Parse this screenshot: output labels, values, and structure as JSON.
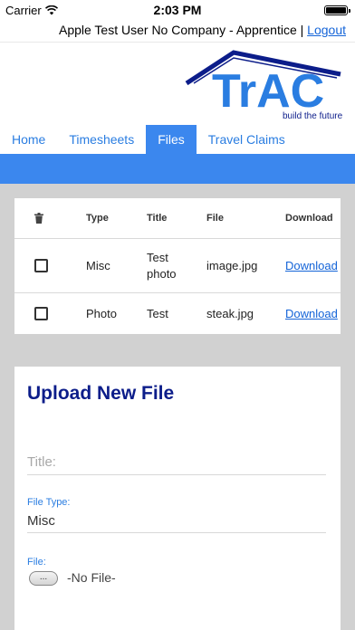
{
  "status_bar": {
    "carrier": "Carrier",
    "time": "2:03 PM",
    "wifi_icon": "wifi-icon",
    "battery_icon": "battery-icon"
  },
  "user_bar": {
    "user_text": "Apple Test User No Company - Apprentice |",
    "logout_label": "Logout"
  },
  "logo": {
    "text": "TrAC",
    "tagline": "build the future",
    "color": "#2a7de1",
    "roof_color": "#0c1d8a"
  },
  "tabs": [
    {
      "label": "Home",
      "active": false
    },
    {
      "label": "Timesheets",
      "active": false
    },
    {
      "label": "Files",
      "active": true
    },
    {
      "label": "Travel Claims",
      "active": false
    }
  ],
  "files_table": {
    "delete_icon": "trash-icon",
    "columns": [
      "Type",
      "Title",
      "File",
      "Download"
    ],
    "rows": [
      {
        "type": "Misc",
        "title_line1": "Test",
        "title_line2": "photo",
        "file": "image.jpg",
        "download": "Download"
      },
      {
        "type": "Photo",
        "title_line1": "Test",
        "title_line2": "",
        "file": "steak.jpg",
        "download": "Download"
      }
    ]
  },
  "upload": {
    "heading": "Upload New File",
    "title_placeholder": "Title:",
    "file_type_label": "File Type:",
    "file_type_value": "Misc",
    "file_label": "File:",
    "file_button": "...",
    "file_status": "-No File-"
  },
  "colors": {
    "accent": "#3b87ee",
    "link": "#1464d8",
    "heading": "#0c1d8a",
    "background_gray": "#d1d1d1"
  }
}
